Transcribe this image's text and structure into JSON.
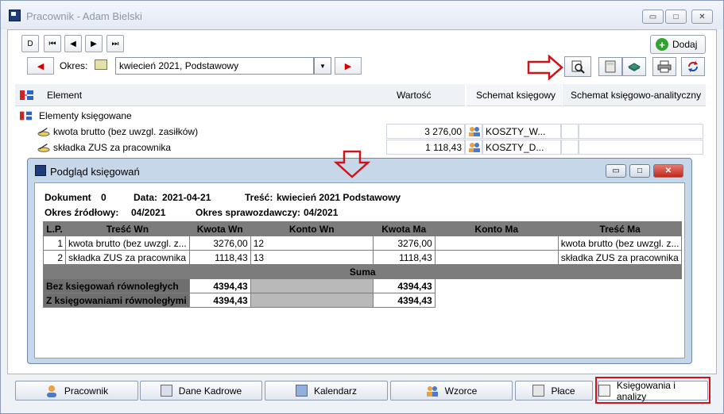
{
  "window": {
    "title": "Pracownik - Adam Bielski",
    "min_label": "▭",
    "max_label": "□",
    "close_label": "✕"
  },
  "nav": {
    "first": "D",
    "prev_first": "⏮",
    "prev": "◀",
    "next": "▶",
    "last": "⏭"
  },
  "add_button": "Dodaj",
  "period": {
    "label": "Okres:",
    "value": "kwiecień 2021, Podstawowy"
  },
  "grid": {
    "headers": {
      "element": "Element",
      "wartosc": "Wartość",
      "schemat": "Schemat księgowy",
      "schemat_analityczny": "Schemat księgowo-analityczny"
    },
    "group": "Elementy księgowane",
    "rows": [
      {
        "name": "kwota brutto (bez uwzgl. zasiłków)",
        "value": "3 276,00",
        "schema": "KOSZTY_W..."
      },
      {
        "name": "składka ZUS za pracownika",
        "value": "1 118,43",
        "schema": "KOSZTY_D..."
      }
    ]
  },
  "modal": {
    "title": "Podgląd księgowań",
    "dokument_label": "Dokument",
    "dokument_value": "0",
    "data_label": "Data:",
    "data_value": "2021-04-21",
    "tresc_label": "Treść:",
    "tresc_value": "kwiecień 2021 Podstawowy",
    "okres_zrodlowy_label": "Okres źródłowy:",
    "okres_zrodlowy_value": "04/2021",
    "okres_sprawozdawczy_label": "Okres sprawozdawczy:",
    "okres_sprawozdawczy_value": "04/2021",
    "columns": [
      "L.P.",
      "Treść Wn",
      "Kwota Wn",
      "Konto Wn",
      "Kwota Ma",
      "Konto Ma",
      "Treść Ma"
    ],
    "rows": [
      {
        "lp": "1",
        "tresc_wn": "kwota brutto (bez uwzgl. z...",
        "kwota_wn": "3276,00",
        "konto_wn": "12",
        "kwota_ma": "3276,00",
        "konto_ma": "",
        "tresc_ma": "kwota brutto (bez uwzgl. z..."
      },
      {
        "lp": "2",
        "tresc_wn": "składka ZUS za pracownika",
        "kwota_wn": "1118,43",
        "konto_wn": "13",
        "kwota_ma": "1118,43",
        "konto_ma": "",
        "tresc_ma": "składka ZUS za pracownika"
      }
    ],
    "suma_label": "Suma",
    "sums": [
      {
        "label": "Bez księgowań równoległych",
        "kwota_wn": "4394,43",
        "kwota_ma": "4394,43"
      },
      {
        "label": "Z księgowaniami równoległymi",
        "kwota_wn": "4394,43",
        "kwota_ma": "4394,43"
      }
    ]
  },
  "tabs": [
    {
      "label": "Pracownik"
    },
    {
      "label": "Dane Kadrowe"
    },
    {
      "label": "Kalendarz"
    },
    {
      "label": "Wzorce"
    },
    {
      "label": "Płace"
    },
    {
      "label": "Księgowania i analizy"
    }
  ],
  "colors": {
    "highlight_red": "#d0121b",
    "modal_frame": "#c7d7ea"
  }
}
